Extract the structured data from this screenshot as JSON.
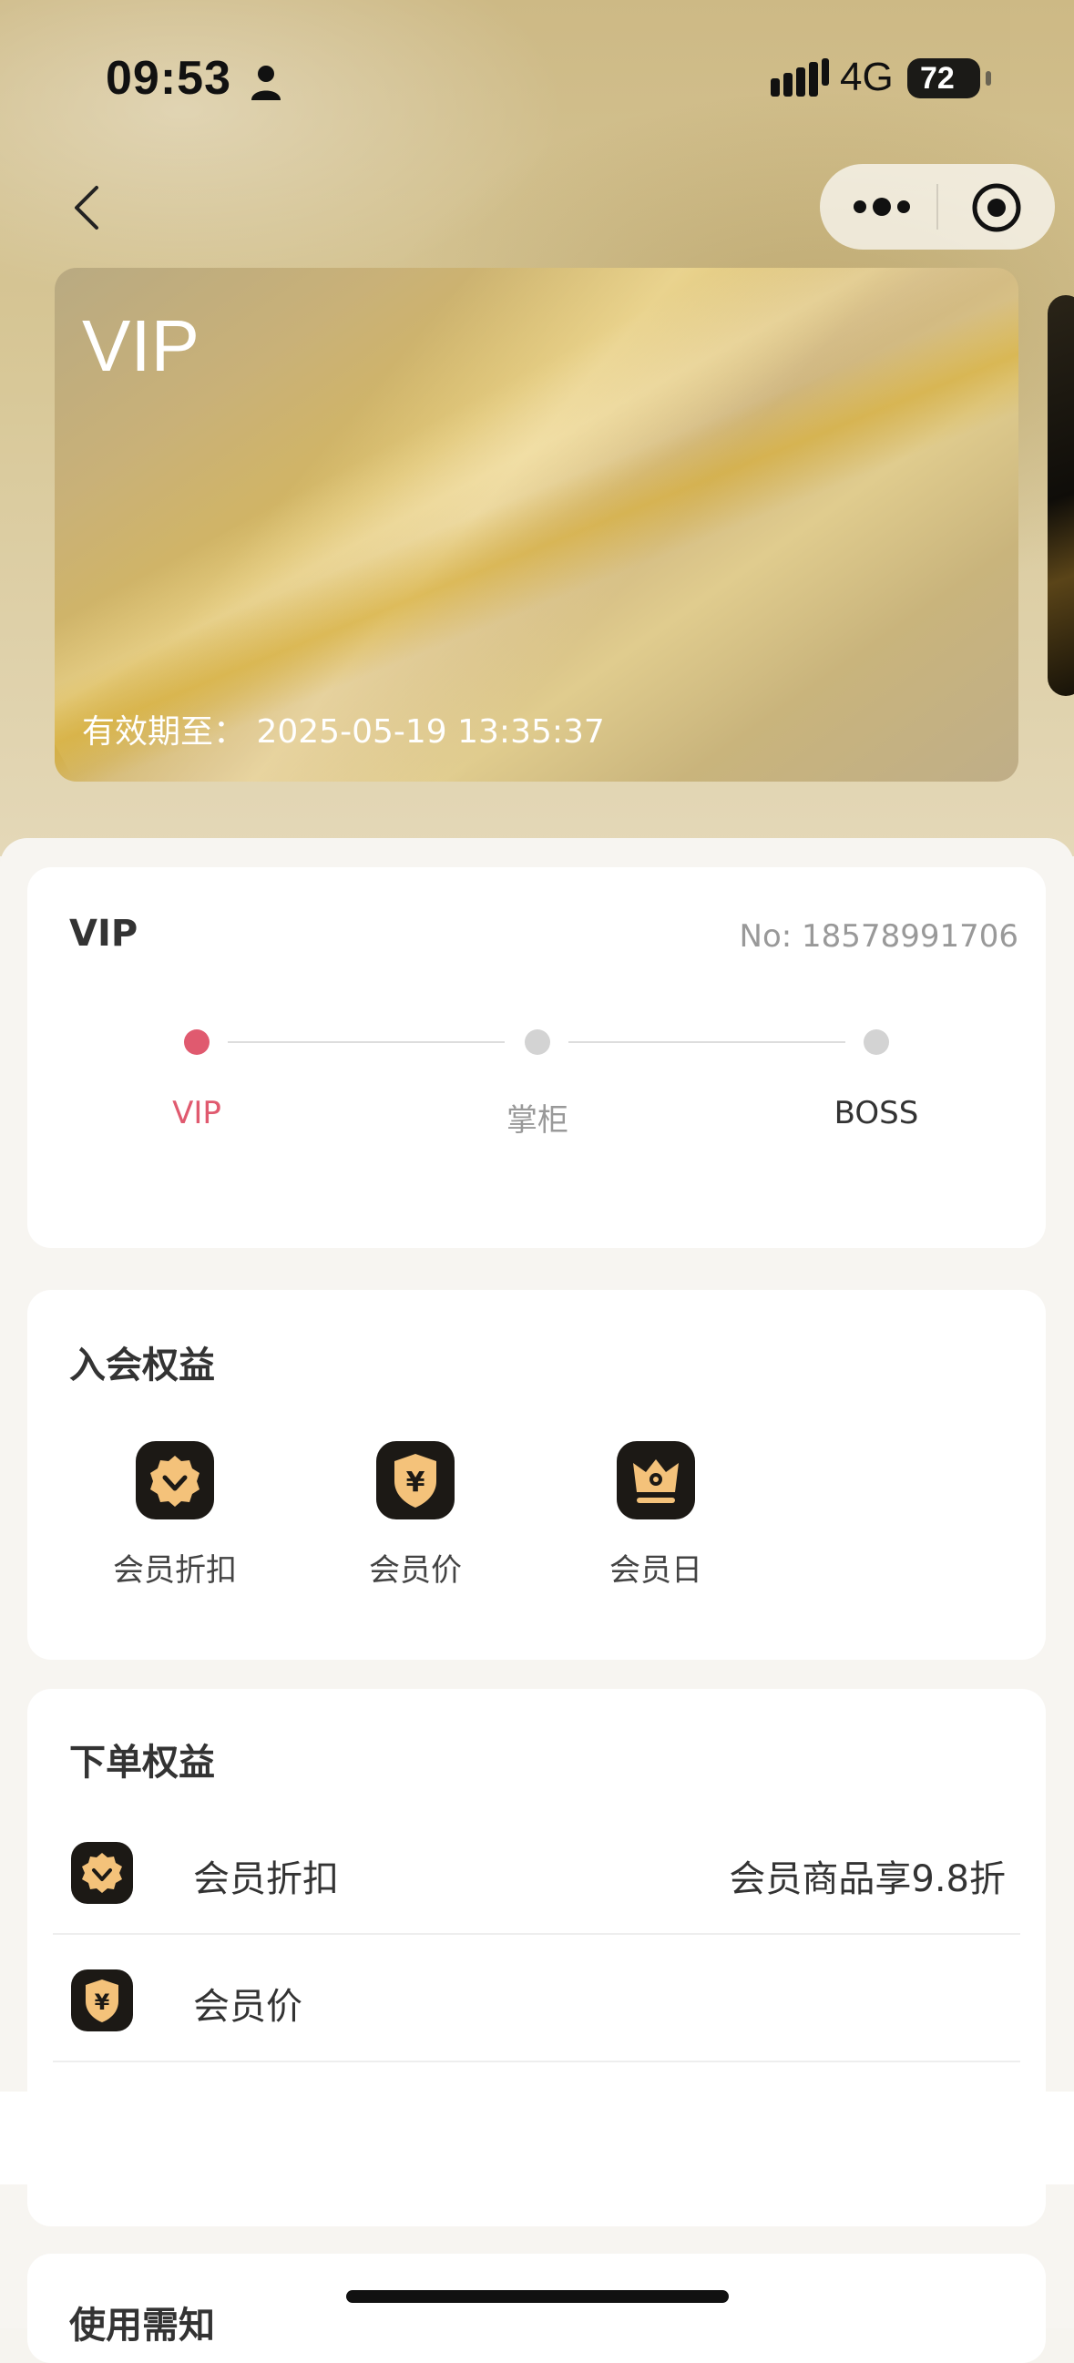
{
  "status_bar": {
    "time": "09:53",
    "network": "4G",
    "battery": "72"
  },
  "card": {
    "title": "VIP",
    "expiry_label": "有效期至：",
    "expiry_value": "2025-05-19 13:35:37"
  },
  "level_panel": {
    "current_level": "VIP",
    "member_no": "No: 18578991706",
    "levels": [
      {
        "label": "VIP",
        "active": true
      },
      {
        "label": "掌柜",
        "active": false
      },
      {
        "label": "BOSS",
        "active": false
      }
    ],
    "active_color": "#e05a6f"
  },
  "join_benefits": {
    "title": "入会权益",
    "items": [
      {
        "label": "会员折扣",
        "icon": "discount-badge-icon"
      },
      {
        "label": "会员价",
        "icon": "yen-shield-icon"
      },
      {
        "label": "会员日",
        "icon": "crown-icon"
      }
    ]
  },
  "order_benefits": {
    "title": "下单权益",
    "rows": [
      {
        "label": "会员折扣",
        "value": "会员商品享9.8折",
        "icon": "discount-badge-icon"
      },
      {
        "label": "会员价",
        "value": "",
        "icon": "yen-shield-icon"
      }
    ]
  },
  "notice": {
    "title": "使用需知"
  },
  "colors": {
    "accent_gold": "#f4c27a",
    "icon_bg": "#1c1915"
  }
}
